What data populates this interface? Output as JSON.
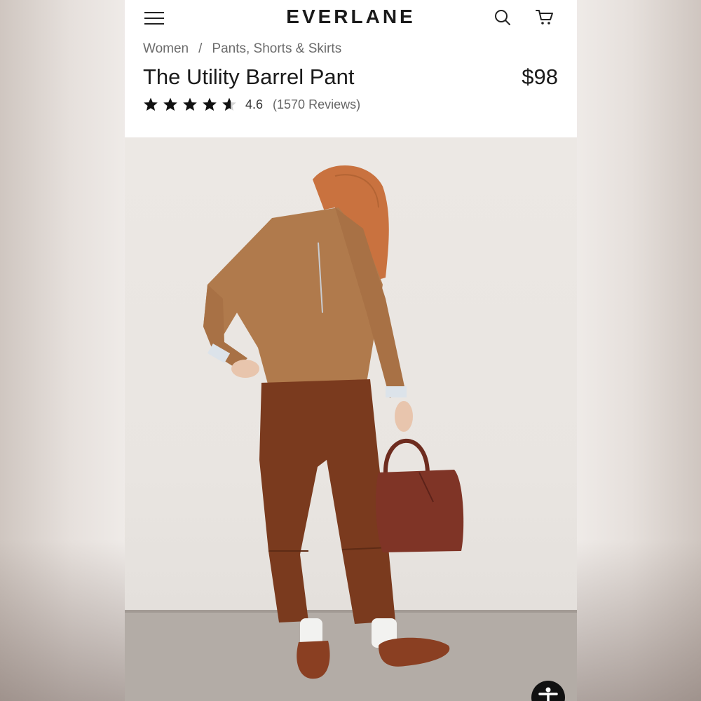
{
  "header": {
    "brand": "EVERLANE",
    "menu_icon": "menu-icon",
    "search_icon": "search-icon",
    "cart_icon": "cart-icon"
  },
  "breadcrumb": {
    "items": [
      "Women",
      "Pants, Shorts & Skirts"
    ],
    "separator": "/"
  },
  "product": {
    "title": "The Utility Barrel Pant",
    "price": "$98",
    "rating": "4.6",
    "rating_value": 4.6,
    "reviews": "(1570 Reviews)"
  },
  "hero": {
    "image_label": "product-photo",
    "accessibility_icon": "accessibility-icon"
  },
  "colors": {
    "text": "#1a1a1a",
    "muted": "#6b6b6b",
    "pant_brown": "#7a3a1e",
    "sweater_camel": "#b07a4c",
    "bag": "#7f3426"
  }
}
